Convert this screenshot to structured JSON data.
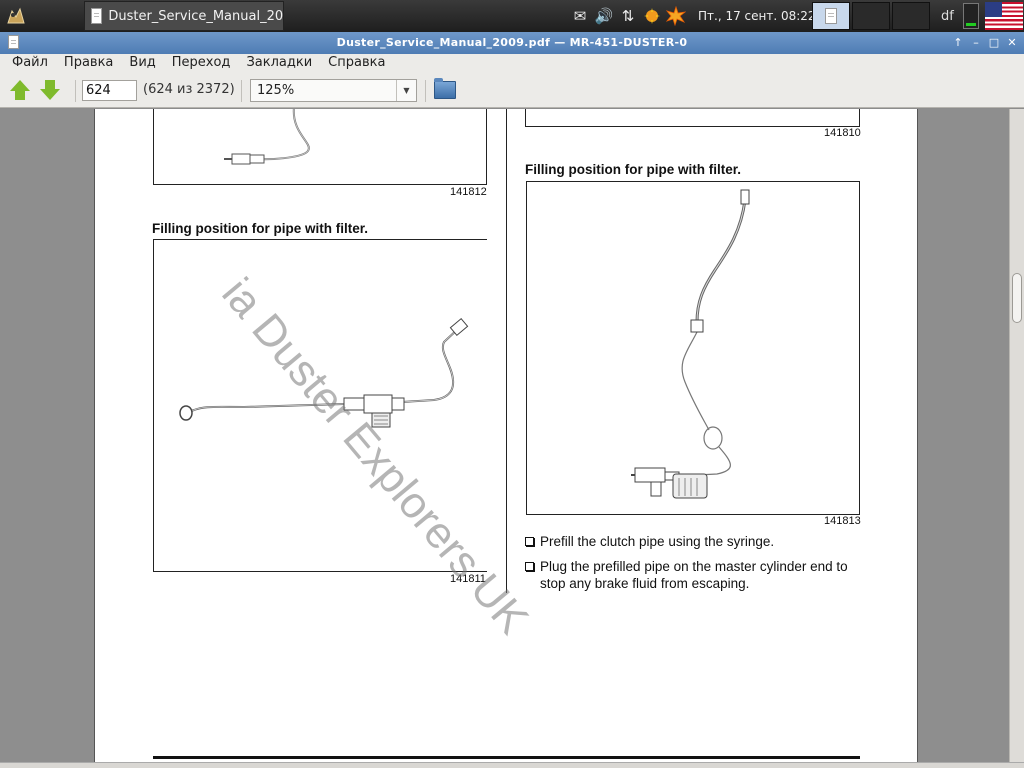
{
  "taskbar": {
    "task_label": "Duster_Service_Manual_20...",
    "clock": "Пт., 17 сент.  08:22",
    "user": "df",
    "icons": [
      "app-menu-icon",
      "mail-icon",
      "volume-icon",
      "network-icon",
      "update-icon",
      "alert-icon"
    ]
  },
  "window": {
    "title": "Duster_Service_Manual_2009.pdf — MR-451-DUSTER-0",
    "controls": [
      "↑",
      "–",
      "□",
      "✕"
    ]
  },
  "menu": {
    "items": [
      "Файл",
      "Правка",
      "Вид",
      "Переход",
      "Закладки",
      "Справка"
    ]
  },
  "toolbar": {
    "page_value": "624",
    "page_count": "(624 из 2372)",
    "zoom": "125%"
  },
  "document": {
    "left_top_fignum": "141812",
    "left_caption": "Filling position for pipe with filter.",
    "left_fignum": "141811",
    "right_top_fignum": "141810",
    "right_caption": "Filling position for pipe with filter.",
    "right_fignum": "141813",
    "bullets": [
      "Prefill the clutch pipe using the syringe.",
      "Plug the prefilled pipe on the master cylinder end to stop any brake fluid from escaping."
    ],
    "watermark": "ia Duster Explorers UK"
  },
  "scroll": {
    "fraction": 0.27
  },
  "colors": {
    "titlebar": "#5a87bf",
    "chrome": "#ecebe8",
    "arrow": "#7fba2c"
  }
}
